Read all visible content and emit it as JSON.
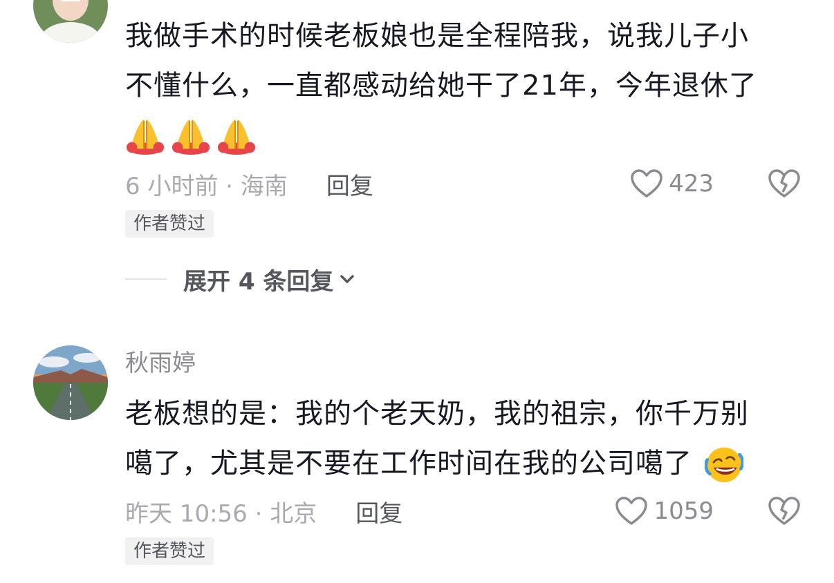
{
  "comments": [
    {
      "text_line1": "我做手术的时候老板娘也是全程陪我，说我儿子小",
      "text_line2": "不懂什么，一直都感动给她干了21年，今年退休了",
      "emoji": "folded-hands",
      "time_location": "6 小时前 · 海南",
      "reply_label": "回复",
      "like_count": "423",
      "badge": "作者赞过"
    },
    {
      "username": "秋雨婷",
      "text_line1": "老板想的是：我的个老天奶，我的祖宗，你千万别",
      "text_line2": "噶了，尤其是不要在工作时间在我的公司噶了",
      "emoji": "rolling-laughing",
      "time_location": "昨天 10:56 · 北京",
      "reply_label": "回复",
      "like_count": "1059",
      "badge": "作者赞过"
    }
  ],
  "expand": {
    "label": "展开 4 条回复"
  },
  "colors": {
    "text_primary": "#161823",
    "text_secondary": "#a9aab0",
    "reply": "#55575f",
    "badge_bg": "#f1f1f2"
  },
  "icons": [
    "heart-icon",
    "broken-heart-icon",
    "chevron-down-icon"
  ]
}
